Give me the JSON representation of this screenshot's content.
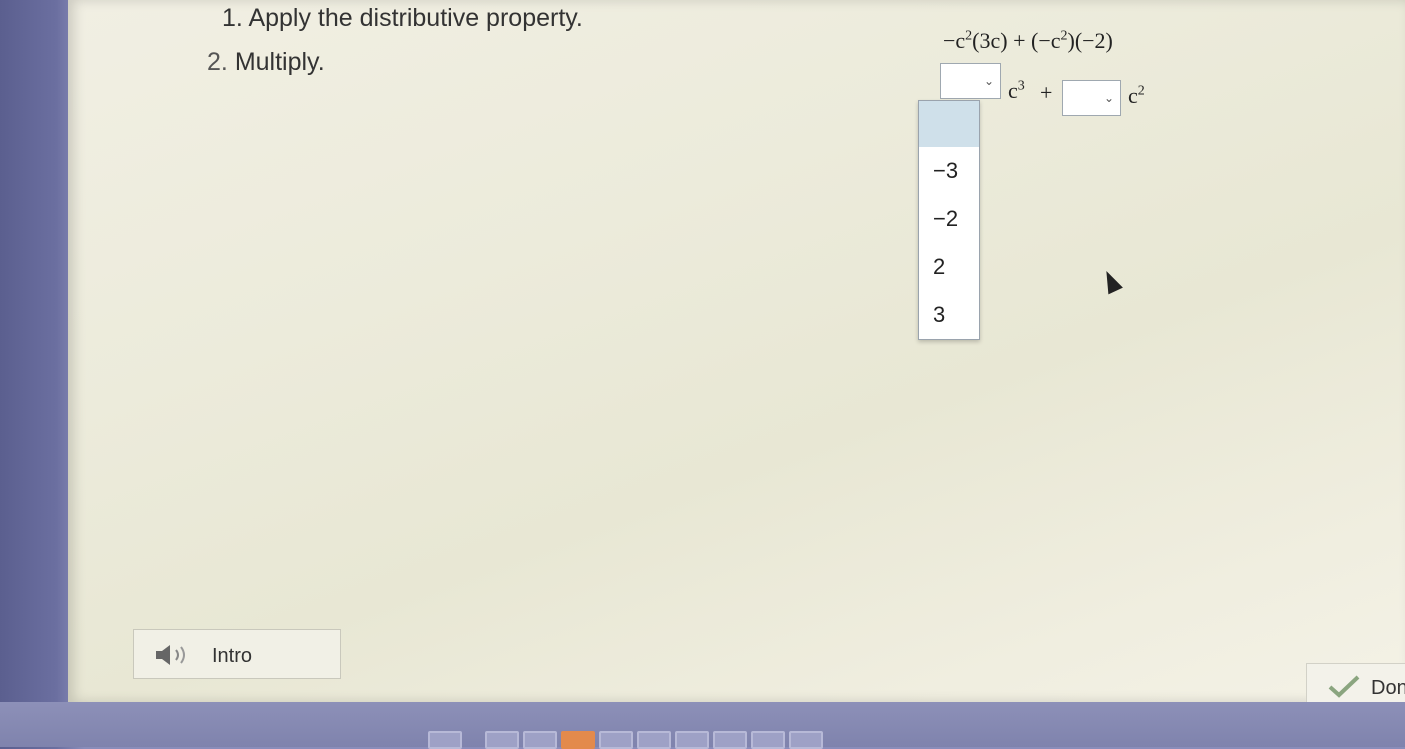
{
  "steps": [
    {
      "number": "1.",
      "text": "Apply the distributive property."
    },
    {
      "number": "2.",
      "text": "Multiply."
    }
  ],
  "expression": {
    "line1": {
      "a": "−c",
      "a_sup": "2",
      "b": "(3c) + (−c",
      "b_sup": "2",
      "c": ")(−2)"
    },
    "line2": {
      "term1_var": "c",
      "term1_sup": "3",
      "plus": "+",
      "term2_var": "c",
      "term2_sup": "2"
    }
  },
  "dropdown_options": [
    "",
    "−3",
    "−2",
    "2",
    "3"
  ],
  "buttons": {
    "intro": "Intro",
    "done": "Don"
  },
  "icons": {
    "select_arrow": "chevron-down-icon",
    "intro": "speaker-icon",
    "done": "check-icon"
  },
  "colors": {
    "highlight": "#cfe0ea",
    "active_progress": "#e38a4c"
  }
}
